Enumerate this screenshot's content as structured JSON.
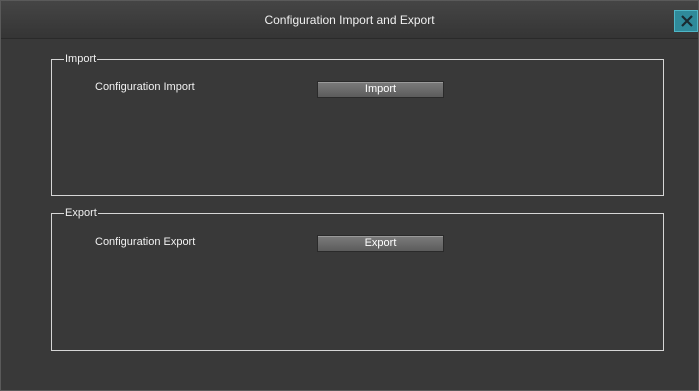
{
  "window": {
    "title": "Configuration Import and Export",
    "close_icon": "close-icon"
  },
  "import_group": {
    "legend": "Import",
    "row_label": "Configuration Import",
    "button_label": "Import"
  },
  "export_group": {
    "legend": "Export",
    "row_label": "Configuration Export",
    "button_label": "Export"
  },
  "colors": {
    "background": "#393939",
    "close_button": "#2f8a9a",
    "border": "#d6d6d6"
  }
}
